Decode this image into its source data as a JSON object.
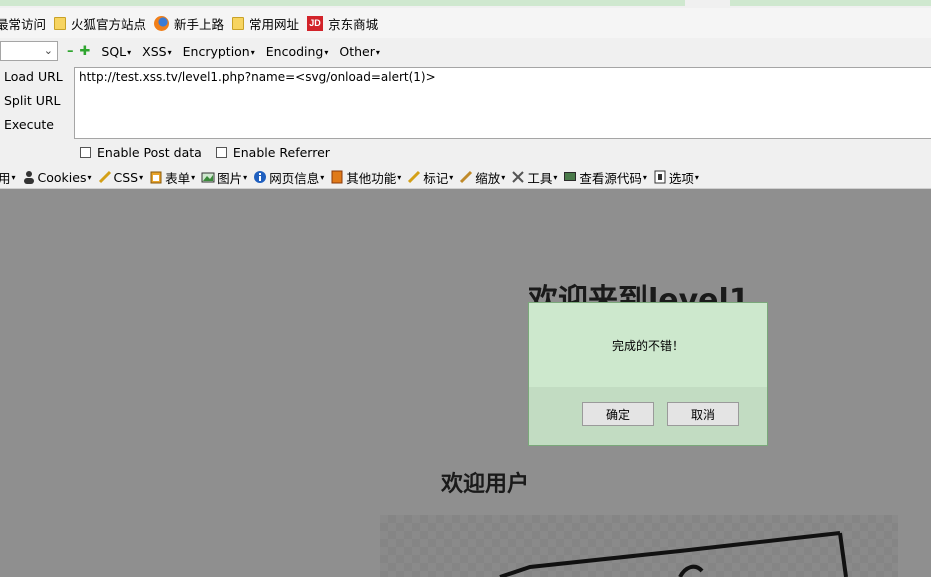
{
  "bookmarks": [
    {
      "label": "最常访问",
      "icon": "none"
    },
    {
      "label": "火狐官方站点",
      "icon": "folder"
    },
    {
      "label": "新手上路",
      "icon": "firefox"
    },
    {
      "label": "常用网址",
      "icon": "folder"
    },
    {
      "label": "京东商城",
      "icon": "jd"
    }
  ],
  "jd_badge": "JD",
  "hackbar": {
    "menus": [
      "SQL",
      "XSS",
      "Encryption",
      "Encoding",
      "Other"
    ],
    "side": {
      "load": "Load URL",
      "split": "Split URL",
      "execute": "Execute"
    },
    "url_value": "http://test.xss.tv/level1.php?name=<svg/onload=alert(1)>",
    "enable_post": "Enable Post data",
    "enable_referrer": "Enable Referrer"
  },
  "devbar": {
    "items": [
      "用",
      "Cookies",
      "CSS",
      "表单",
      "图片",
      "网页信息",
      "其他功能",
      "标记",
      "缩放",
      "工具",
      "查看源代码",
      "选项"
    ]
  },
  "page": {
    "heading": "欢迎来到level1",
    "welcome_user": "欢迎用户"
  },
  "dialog": {
    "message": "完成的不错！",
    "ok": "确定",
    "cancel": "取消"
  }
}
